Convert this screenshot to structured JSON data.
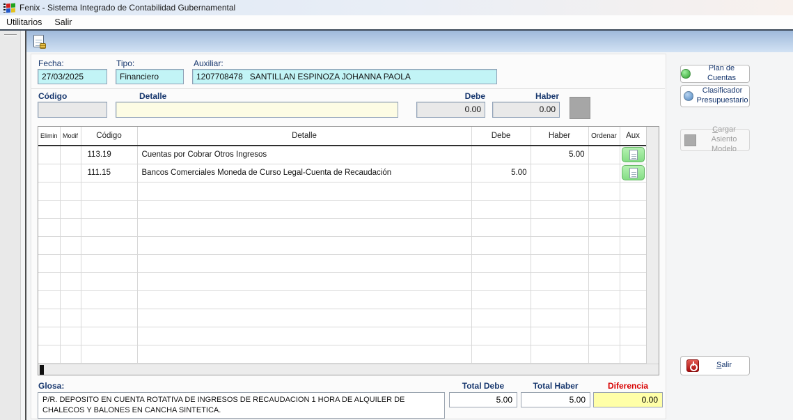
{
  "window": {
    "title": "Fenix - Sistema Integrado de Contabilidad Gubernamental",
    "icon": "windows-logo-icon"
  },
  "menu": {
    "items": [
      "Utilitarios",
      "Salir"
    ]
  },
  "toolbar": {
    "icon": "new-entry-document-icon"
  },
  "header_form": {
    "fecha_label": "Fecha:",
    "fecha_value": "27/03/2025",
    "tipo_label": "Tipo:",
    "tipo_value": "Financiero",
    "auxiliar_label": "Auxiliar:",
    "auxiliar_value": "1207708478   SANTILLAN ESPINOZA JOHANNA PAOLA"
  },
  "entry_row": {
    "codigo_label": "Código",
    "codigo_value": "",
    "detalle_label": "Detalle",
    "detalle_value": "",
    "debe_label": "Debe",
    "debe_value": "0.00",
    "haber_label": "Haber",
    "haber_value": "0.00"
  },
  "table": {
    "columns": [
      "Elimin",
      "Modif",
      "Código",
      "Detalle",
      "Debe",
      "Haber",
      "Ordenar",
      "Aux"
    ],
    "rows": [
      {
        "elimin": "",
        "modif": "",
        "codigo": "113.19",
        "detalle": "Cuentas por Cobrar Otros Ingresos",
        "debe": "",
        "haber": "5.00",
        "ordenar": "",
        "aux_icon": "document-icon"
      },
      {
        "elimin": "",
        "modif": "",
        "codigo": "111.15",
        "detalle": "Bancos Comerciales Moneda de Curso Legal-Cuenta de Recaudación",
        "debe": "5.00",
        "haber": "",
        "ordenar": "",
        "aux_icon": "document-icon"
      }
    ],
    "empty_rows": 10
  },
  "side_panel": {
    "plan_de_cuentas": {
      "label": "Plan de Cuentas",
      "icon": "green-sphere-icon"
    },
    "clasificador": {
      "label": "Clasificador Presupuestario",
      "icon": "blue-sphere-icon"
    },
    "cargar_asiento": {
      "label": "Cargar Asiento Modelo",
      "icon": "gray-square-icon",
      "enabled": false
    },
    "salir": {
      "label": "Salir",
      "icon": "power-icon"
    }
  },
  "footer": {
    "glosa_label": "Glosa:",
    "glosa_value": "P/R. DEPOSITO EN CUENTA ROTATIVA DE INGRESOS DE RECAUDACION  1 HORA DE ALQUILER DE CHALECOS Y BALONES EN CANCHA SINTETICA.",
    "total_debe_label": "Total Debe",
    "total_debe_value": "5.00",
    "total_haber_label": "Total Haber",
    "total_haber_value": "5.00",
    "diferencia_label": "Diferencia",
    "diferencia_value": "0.00"
  },
  "colors": {
    "label_navy": "#17376e",
    "field_cyan": "#c2f4f6",
    "field_yellow": "#fdfce4",
    "diferencia_red": "#d80000",
    "diff_field_yellow": "#ffffa8",
    "aux_button_green": "#97e494",
    "toolbar_top": "#9fb9da",
    "toolbar_bottom": "#d2e2f4"
  }
}
